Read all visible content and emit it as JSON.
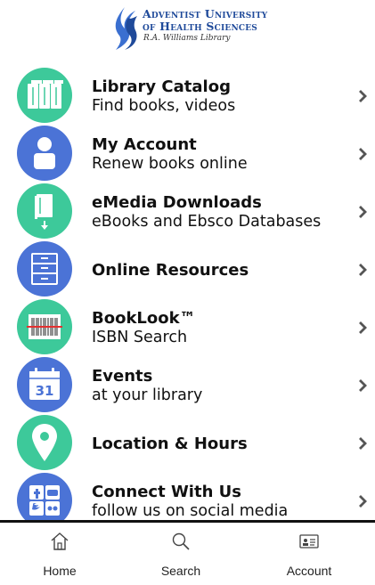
{
  "header": {
    "logo_line1": "Adventist University",
    "logo_line2": "of Health Sciences",
    "logo_line3": "R.A. Williams Library"
  },
  "menu": [
    {
      "title": "Library Catalog",
      "subtitle": "Find books, videos",
      "icon": "books-icon",
      "color": "#3dc99a"
    },
    {
      "title": "My Account",
      "subtitle": "Renew books online",
      "icon": "person-icon",
      "color": "#4b73d6"
    },
    {
      "title": "eMedia Downloads",
      "subtitle": "eBooks and Ebsco Databases",
      "icon": "ebook-download-icon",
      "color": "#3dc99a"
    },
    {
      "title": "Online Resources",
      "subtitle": "",
      "icon": "file-cabinet-icon",
      "color": "#4b73d6"
    },
    {
      "title": "BookLook™",
      "subtitle": "ISBN Search",
      "icon": "barcode-icon",
      "color": "#3dc99a"
    },
    {
      "title": "Events",
      "subtitle": "at your library",
      "icon": "calendar-icon",
      "color": "#4b73d6",
      "calendar_day": "31"
    },
    {
      "title": "Location & Hours",
      "subtitle": "",
      "icon": "map-pin-icon",
      "color": "#3dc99a"
    },
    {
      "title": "Connect With Us",
      "subtitle": "follow us on social media",
      "icon": "social-media-icon",
      "color": "#4b73d6"
    }
  ],
  "tabs": [
    {
      "label": "Home",
      "icon": "home-icon"
    },
    {
      "label": "Search",
      "icon": "search-icon"
    },
    {
      "label": "Account",
      "icon": "id-card-icon"
    }
  ]
}
